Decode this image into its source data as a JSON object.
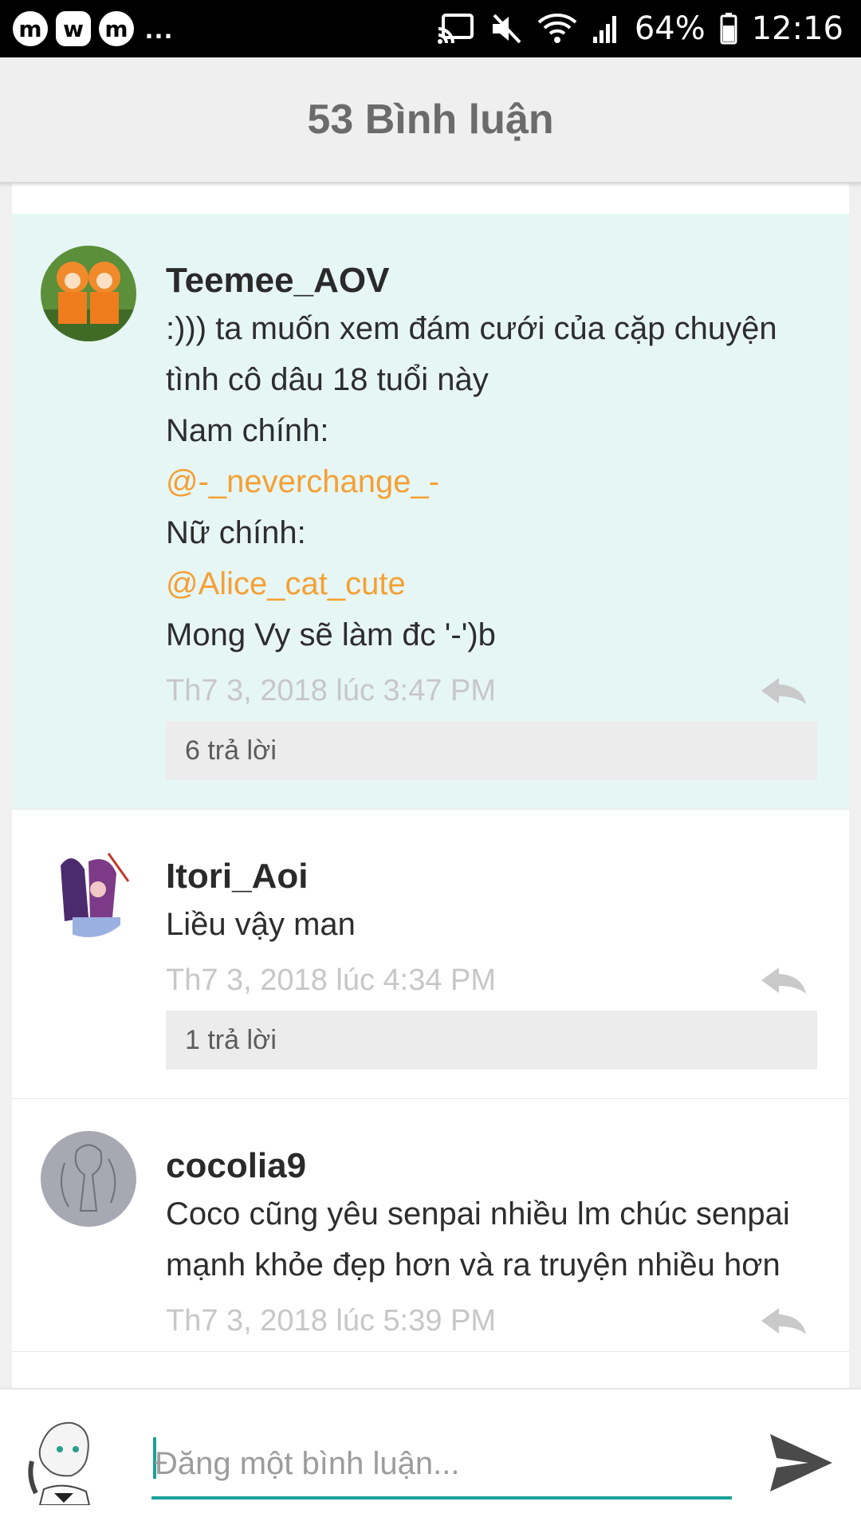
{
  "status_bar": {
    "app_icons": [
      "m",
      "w",
      "m"
    ],
    "more": "...",
    "battery": "64%",
    "time": "12:16"
  },
  "header": {
    "title": "53 Bình luận"
  },
  "comments": [
    {
      "username": "Teemee_AOV",
      "highlighted": true,
      "lines": [
        ":))) ta muốn xem đám cưới của cặp chuyện",
        "tình cô dâu 18 tuổi này",
        "Nam chính:",
        "@-_neverchange_-",
        "Nữ chính:",
        "@Alice_cat_cute",
        "Mong Vy sẽ làm đc '-')b"
      ],
      "date": "Th7 3, 2018 lúc 3:47 PM",
      "replies": "6 trả lời"
    },
    {
      "username": "Itori_Aoi",
      "lines": [
        "Liều vậy man"
      ],
      "date": "Th7 3, 2018 lúc 4:34 PM",
      "replies": "1 trả lời"
    },
    {
      "username": "cocolia9",
      "lines": [
        "Coco cũng yêu senpai nhiều lm chúc senpai",
        "mạnh khỏe đẹp hơn và ra truyện nhiều hơn"
      ],
      "date": "Th7 3, 2018 lúc 5:39 PM"
    }
  ],
  "composer": {
    "placeholder": "Đăng một bình luận..."
  },
  "colors": {
    "accent": "#1aa19a",
    "mention": "#f5a034",
    "highlight_bg": "#e6f6f5"
  },
  "icons": [
    "cast-icon",
    "mute-icon",
    "wifi-icon",
    "signal-icon",
    "battery-icon",
    "reply-icon",
    "send-icon"
  ]
}
